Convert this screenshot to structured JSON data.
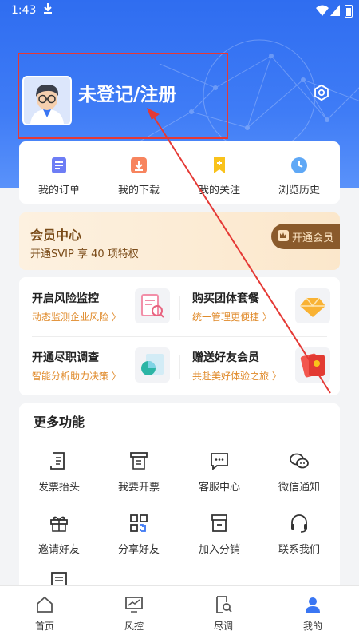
{
  "status": {
    "time": "1:43"
  },
  "profile": {
    "login_label": "未登记/注册"
  },
  "quick": [
    {
      "label": "我的订单",
      "icon": "order-icon"
    },
    {
      "label": "我的下载",
      "icon": "download-icon"
    },
    {
      "label": "我的关注",
      "icon": "bookmark-icon"
    },
    {
      "label": "浏览历史",
      "icon": "clock-icon"
    }
  ],
  "vip": {
    "title": "会员中心",
    "subtitle": "开通SVIP 享 40 项特权",
    "button": "开通会员"
  },
  "promo": [
    {
      "title": "开启风险监控",
      "subtitle": "动态监测企业风险 〉"
    },
    {
      "title": "购买团体套餐",
      "subtitle": "统一管理更便捷 〉"
    },
    {
      "title": "开通尽职调查",
      "subtitle": "智能分析助力决策 〉"
    },
    {
      "title": "赠送好友会员",
      "subtitle": "共赴美好体验之旅 〉"
    }
  ],
  "more": {
    "title": "更多功能",
    "items": [
      {
        "label": "发票抬头",
        "icon": "invoice-header-icon"
      },
      {
        "label": "我要开票",
        "icon": "invoice-icon"
      },
      {
        "label": "客服中心",
        "icon": "chat-icon"
      },
      {
        "label": "微信通知",
        "icon": "wechat-icon"
      },
      {
        "label": "邀请好友",
        "icon": "gift-icon"
      },
      {
        "label": "分享好友",
        "icon": "qrcode-icon"
      },
      {
        "label": "加入分销",
        "icon": "store-icon"
      },
      {
        "label": "联系我们",
        "icon": "headset-icon"
      }
    ]
  },
  "tabs": [
    {
      "label": "首页",
      "icon": "home-icon"
    },
    {
      "label": "风控",
      "icon": "chart-monitor-icon"
    },
    {
      "label": "尽调",
      "icon": "doc-search-icon"
    },
    {
      "label": "我的",
      "icon": "user-icon"
    }
  ],
  "colors": {
    "brand": "#3a76f3",
    "annotation": "#e53935",
    "vip_text": "#7a4b18",
    "promo_sub": "#e08a2a"
  }
}
